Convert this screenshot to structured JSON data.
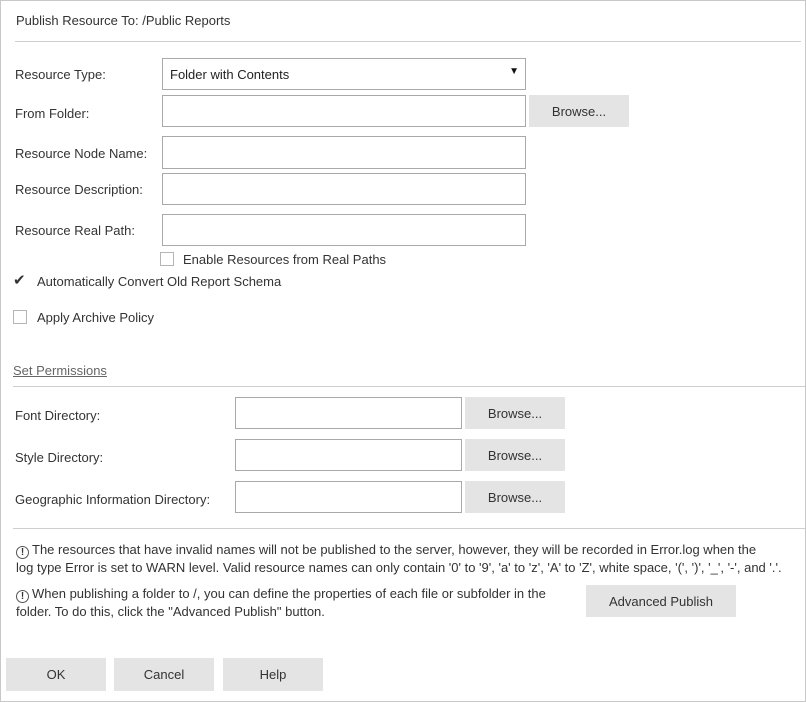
{
  "dialog": {
    "title_prefix": "Publish Resource To:",
    "title_path": "/Public Reports"
  },
  "form": {
    "resource_type": {
      "label": "Resource Type:",
      "value": "Folder with Contents"
    },
    "from_folder": {
      "label": "From Folder:",
      "value": "",
      "browse_label": "Browse..."
    },
    "resource_node_name": {
      "label": "Resource Node Name:",
      "value": ""
    },
    "resource_description": {
      "label": "Resource Description:",
      "value": ""
    },
    "resource_real_path": {
      "label": "Resource Real Path:",
      "value": ""
    },
    "enable_real_paths": {
      "label": "Enable Resources from Real Paths",
      "checked": false
    },
    "auto_convert": {
      "label": "Automatically Convert Old Report Schema",
      "checked": true
    },
    "archive_policy": {
      "label": "Apply Archive Policy",
      "checked": false
    }
  },
  "permissions": {
    "link_label": "Set Permissions"
  },
  "directories": {
    "font": {
      "label": "Font Directory:",
      "value": "",
      "browse_label": "Browse..."
    },
    "style": {
      "label": "Style Directory:",
      "value": "",
      "browse_label": "Browse..."
    },
    "geo": {
      "label": "Geographic Information Directory:",
      "value": "",
      "browse_label": "Browse..."
    }
  },
  "notes": {
    "invalid_names_line1": "The resources that have invalid names will not be published to the server, however, they will be recorded in Error.log when the",
    "invalid_names_line2": "log type Error is set to WARN level. Valid resource names can only contain '0' to '9', 'a' to 'z', 'A' to 'Z', white space, '(', ')', '_', '-', and '.'.",
    "publish_line1": "When publishing a folder to /, you can define the properties of each file or subfolder in the",
    "publish_line2": "folder. To do this, click the \"Advanced Publish\" button.",
    "advanced_publish_label": "Advanced Publish"
  },
  "footer": {
    "ok_label": "OK",
    "cancel_label": "Cancel",
    "help_label": "Help"
  }
}
